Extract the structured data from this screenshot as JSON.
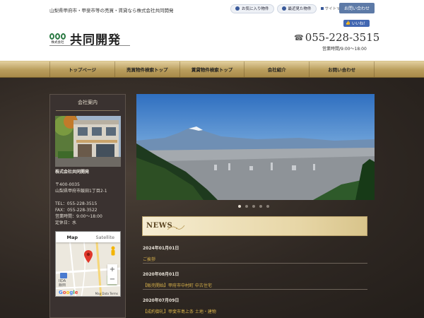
{
  "header": {
    "tagline": "山梨県甲府市・甲斐市等の売買・賃貸なら株式会社共同開発",
    "favorites_label": "お気に入り物件",
    "recent_label": "最近見た物件",
    "sitemap_label": "サイトマップ",
    "contact_label": "お問い合わせ",
    "fb_like_label": "いいね！",
    "logo_small": "株式会社",
    "logo_name": "共同開発",
    "phone": "055-228-3515",
    "hours": "営業時間/9:00～18:00"
  },
  "nav": {
    "items": [
      {
        "label": "トップページ"
      },
      {
        "label": "売買物件検索トップ"
      },
      {
        "label": "賃貸物件検索トップ"
      },
      {
        "label": "会社紹介"
      },
      {
        "label": "お問い合わせ"
      }
    ]
  },
  "sidebar": {
    "title": "会社案内",
    "company_name": "株式会社共同開発",
    "postal": "〒400-0035",
    "address": "山梨県甲府市飯田1丁目2-1",
    "tel": "TEL：055-228-3515",
    "fax": "FAX：055-228-3522",
    "hours": "営業時間：9:00～18:00",
    "holiday": "定休日：水",
    "map": {
      "tab_map": "Map",
      "tab_satellite": "Satellite",
      "zoom_in": "+",
      "zoom_out": "−",
      "area_label_1": "IIDA",
      "area_label_2": "飯田",
      "google": "Google",
      "footer": "Map Data   Terms"
    }
  },
  "slider": {
    "slide_count": 5,
    "active_index": 0
  },
  "news": {
    "title": "NEWS",
    "items": [
      {
        "date": "2024年01月01日",
        "text": "ご挨拶"
      },
      {
        "date": "2020年08月01日",
        "text": "【販売開始】甲府市中村町 中古住宅"
      },
      {
        "date": "2020年07月09日",
        "text": "【成約御礼】甲斐市島上条 土地・建物"
      }
    ]
  },
  "colors": {
    "nav_gold": "#b99d5c",
    "link_gold": "#d9b24a",
    "brand_green": "#2b7a43",
    "contact_blue": "#5d7aa7"
  }
}
